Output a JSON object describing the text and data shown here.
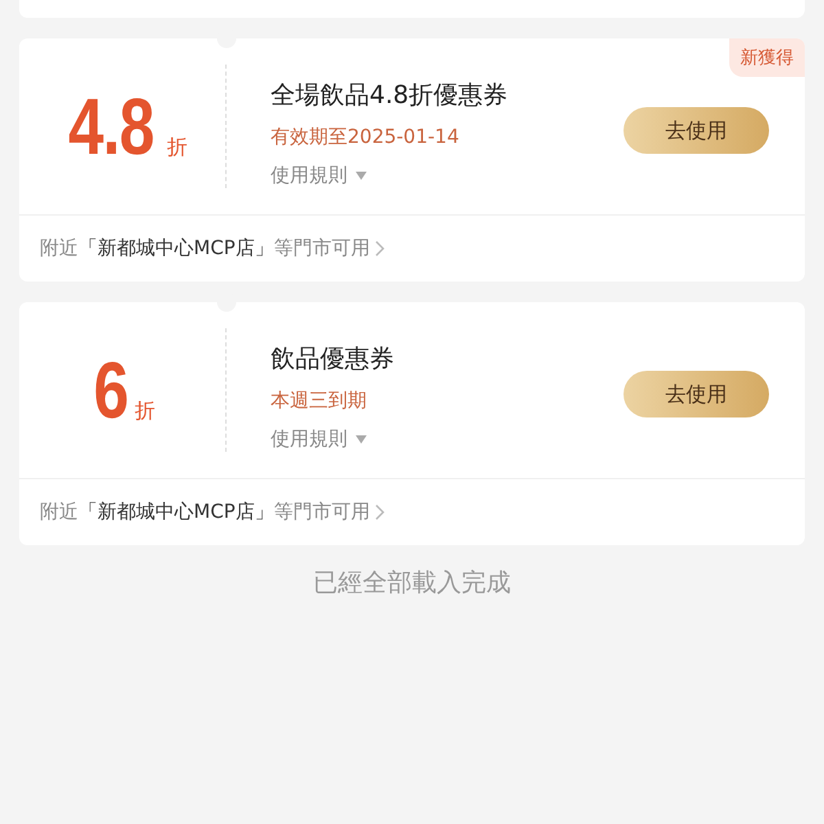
{
  "coupons": [
    {
      "value": "4.8",
      "unit": "折",
      "badge": "新獲得",
      "title": "全場飲品4.8折優惠券",
      "validity": "有效期至2025-01-14",
      "rules_label": "使用規則",
      "button": "去使用",
      "store_prefix": "附近",
      "store_name": "「新都城中心MCP店」",
      "store_suffix": "等門市可用"
    },
    {
      "value": "6",
      "unit": "折",
      "title": "飲品優惠券",
      "validity": "本週三到期",
      "rules_label": "使用規則",
      "button": "去使用",
      "store_prefix": "附近",
      "store_name": "「新都城中心MCP店」",
      "store_suffix": "等門市可用"
    }
  ],
  "footer": "已經全部載入完成"
}
